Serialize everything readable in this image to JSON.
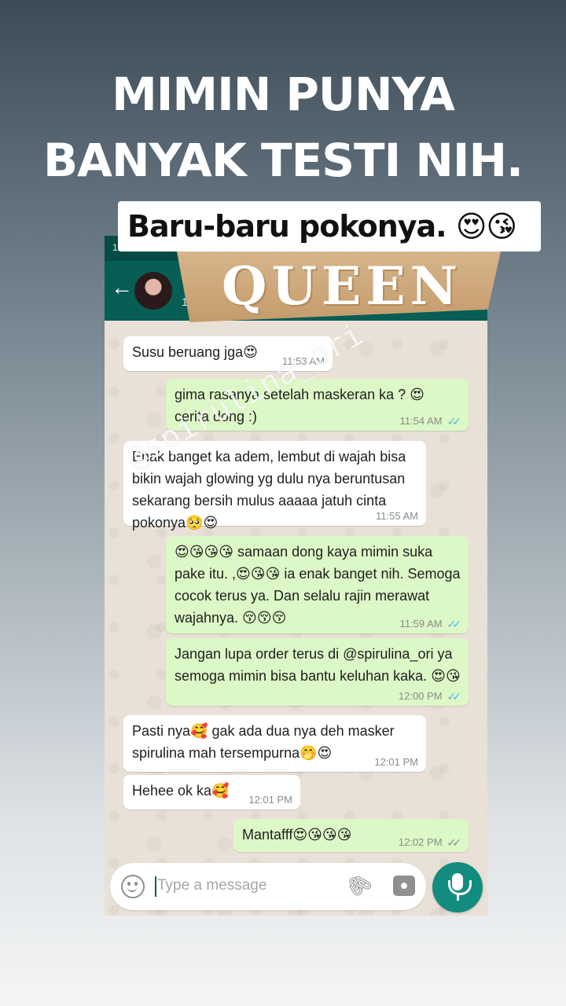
{
  "headline": {
    "line1": "MIMIN PUNYA",
    "line2": "BANYAK TESTI NIH."
  },
  "subtitle": "Baru-baru pokonya. 😍😘",
  "banner": "QUEEN",
  "watermark": "@spirulina_ori",
  "statusbar": {
    "time": "12:3"
  },
  "contact": {
    "last_seen": "12"
  },
  "messages": [
    {
      "dir": "in",
      "text": "Susu beruang jga😍",
      "time": "11:53 AM"
    },
    {
      "dir": "out",
      "text": "gima rasanya setelah maskeran ka ? 😍 cerita dong :)",
      "time": "11:54 AM",
      "status": "read"
    },
    {
      "dir": "in",
      "text": "Enak banget ka adem, lembut di wajah bisa bikin wajah glowing yg dulu nya beruntusan sekarang bersih mulus aaaaa jatuh cinta pokonya🥺😍",
      "time": "11:55 AM"
    },
    {
      "dir": "out",
      "text": "😍😘😘😘 samaan dong kaya mimin suka pake itu. ,😍😘😘 ia enak banget nih. Semoga cocok terus ya. Dan selalu rajin merawat wajahnya. 😚😚😚",
      "time": "11:59 AM",
      "status": "read"
    },
    {
      "dir": "out",
      "text": "Jangan lupa order terus di @spirulina_ori ya  semoga mimin bisa bantu keluhan kaka. 😍😘",
      "time": "12:00 PM",
      "status": "read"
    },
    {
      "dir": "in",
      "text": "Pasti nya🥰 gak ada dua nya deh masker spirulina mah tersempurna🤭😍",
      "time": "12:01 PM"
    },
    {
      "dir": "in",
      "text": "Hehee ok ka🥰",
      "time": "12:01 PM"
    },
    {
      "dir": "out",
      "text": "Mantafff😍😘😘😘",
      "time": "12:02 PM",
      "status": "delivered"
    }
  ],
  "input": {
    "placeholder": "Type a message"
  },
  "icons": {
    "emoji": "emoji-icon",
    "attach": "paperclip-icon",
    "camera": "camera-icon",
    "mic": "mic-icon",
    "back": "back-arrow-icon"
  },
  "colors": {
    "appbar": "#075e54",
    "outgoing_bubble": "#dcf8c6",
    "incoming_bubble": "#ffffff",
    "mic_button": "#128c7e",
    "read_ticks": "#4fb6ec"
  }
}
